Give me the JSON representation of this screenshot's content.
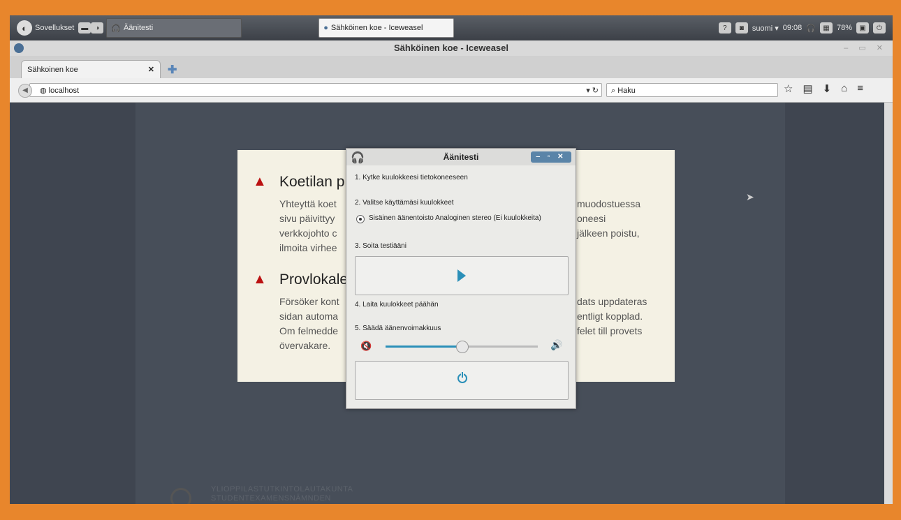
{
  "taskbar": {
    "menu_label": "Sovellukset",
    "task1": "Äänitesti",
    "task2": "Sähköinen koe - Iceweasel",
    "keyboard": "suomi ▾",
    "clock": "09:08",
    "battery": "78%"
  },
  "window": {
    "title": "Sähköinen koe - Iceweasel",
    "tab_label": "Sähkoinen koe",
    "url": "localhost",
    "search_placeholder": "Haku"
  },
  "page": {
    "heading_fi": "Koetilan p",
    "para_fi": [
      "Yhteyttä koet",
      "sivu päivittyy",
      "verkkojohto c",
      "ilmoita virhee"
    ],
    "para_fi_right": [
      "muodostuessa",
      "oneesi",
      "jälkeen poistu,"
    ],
    "heading_sv": "Provlokale",
    "para_sv": [
      "Försöker kont",
      "sidan automa",
      "Om felmedde",
      "övervakare."
    ],
    "para_sv_right": [
      "dats uppdateras",
      "entligt kopplad.",
      "felet till provets"
    ],
    "footer_line1": "YLIOPPILASTUTKINTOLAUTAKUNTA",
    "footer_line2": "STUDENTEXAMENSNÄMNDEN"
  },
  "dialog": {
    "title": "Äänitesti",
    "step1": "1. Kytke kuulokkeesi tietokoneeseen",
    "step2": "2. Valitse käyttämäsi kuulokkeet",
    "radio_option": "Sisäinen äänentoisto Analoginen stereo (Ei kuulokkeita)",
    "step3": "3. Soita testiääni",
    "step4": "4. Laita kuulokkeet päähän",
    "step5": "5. Säädä äänenvoimakkuus",
    "volume_fraction": 0.5
  },
  "colors": {
    "accent": "#2a8fb8",
    "warning": "#b11111",
    "card_bg": "#f4f1e4",
    "frame": "#e8862c"
  }
}
